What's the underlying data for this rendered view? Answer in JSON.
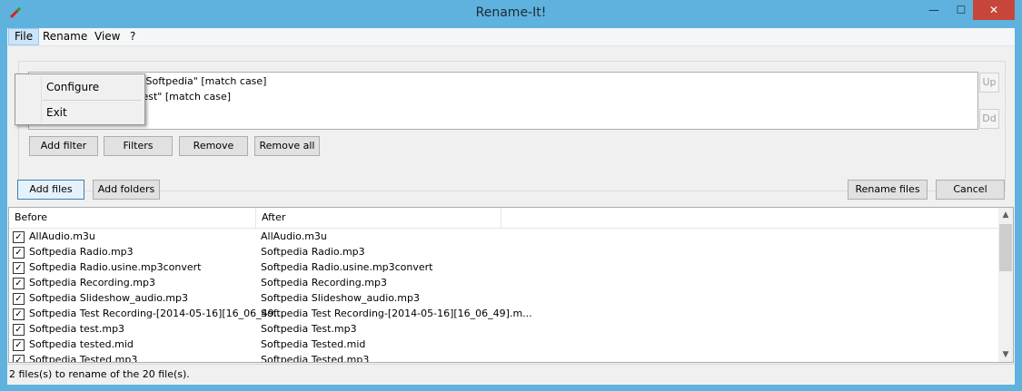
{
  "window": {
    "title": "Rename-It!",
    "min_glyph": "—",
    "max_glyph": "☐",
    "close_glyph": "✕"
  },
  "menu": {
    "items": [
      {
        "label": "File"
      },
      {
        "label": "Rename"
      },
      {
        "label": "View"
      },
      {
        "label": "?"
      }
    ],
    "file_dropdown": {
      "items": [
        {
          "label": "Configure"
        },
        {
          "label": "Exit"
        }
      ]
    }
  },
  "filters": {
    "lines": [
      "h \"Softpedia\" [match case]",
      "Replace \"test\" with \"Test\" [match case]"
    ],
    "up_label": "Up",
    "down_label": "Dd",
    "buttons": {
      "add_filter": "Add filter",
      "filters": "Filters",
      "remove": "Remove",
      "remove_all": "Remove all"
    }
  },
  "files_toolbar": {
    "add_files": "Add files",
    "add_folders": "Add folders",
    "rename_files": "Rename files",
    "cancel": "Cancel"
  },
  "file_list": {
    "columns": {
      "before": "Before",
      "after": "After"
    },
    "rows": [
      {
        "checked": true,
        "before": "AllAudio.m3u",
        "after": "AllAudio.m3u"
      },
      {
        "checked": true,
        "before": "Softpedia Radio.mp3",
        "after": "Softpedia Radio.mp3"
      },
      {
        "checked": true,
        "before": "Softpedia Radio.usine.mp3convert",
        "after": "Softpedia Radio.usine.mp3convert"
      },
      {
        "checked": true,
        "before": "Softpedia Recording.mp3",
        "after": "Softpedia Recording.mp3"
      },
      {
        "checked": true,
        "before": "Softpedia Slideshow_audio.mp3",
        "after": "Softpedia Slideshow_audio.mp3"
      },
      {
        "checked": true,
        "before": "Softpedia Test Recording-[2014-05-16][16_06_49...",
        "after": "Softpedia Test Recording-[2014-05-16][16_06_49].m..."
      },
      {
        "checked": true,
        "before": "Softpedia test.mp3",
        "after": "Softpedia Test.mp3"
      },
      {
        "checked": true,
        "before": "Softpedia tested.mid",
        "after": "Softpedia Tested.mid"
      },
      {
        "checked": true,
        "before": "Softpedia Tested.mp3",
        "after": "Softpedia Tested.mp3"
      }
    ],
    "check_glyph": "✓",
    "scroll_up_glyph": "▲",
    "scroll_down_glyph": "▼"
  },
  "status": {
    "text": "2 files(s) to rename of the 20 file(s)."
  }
}
